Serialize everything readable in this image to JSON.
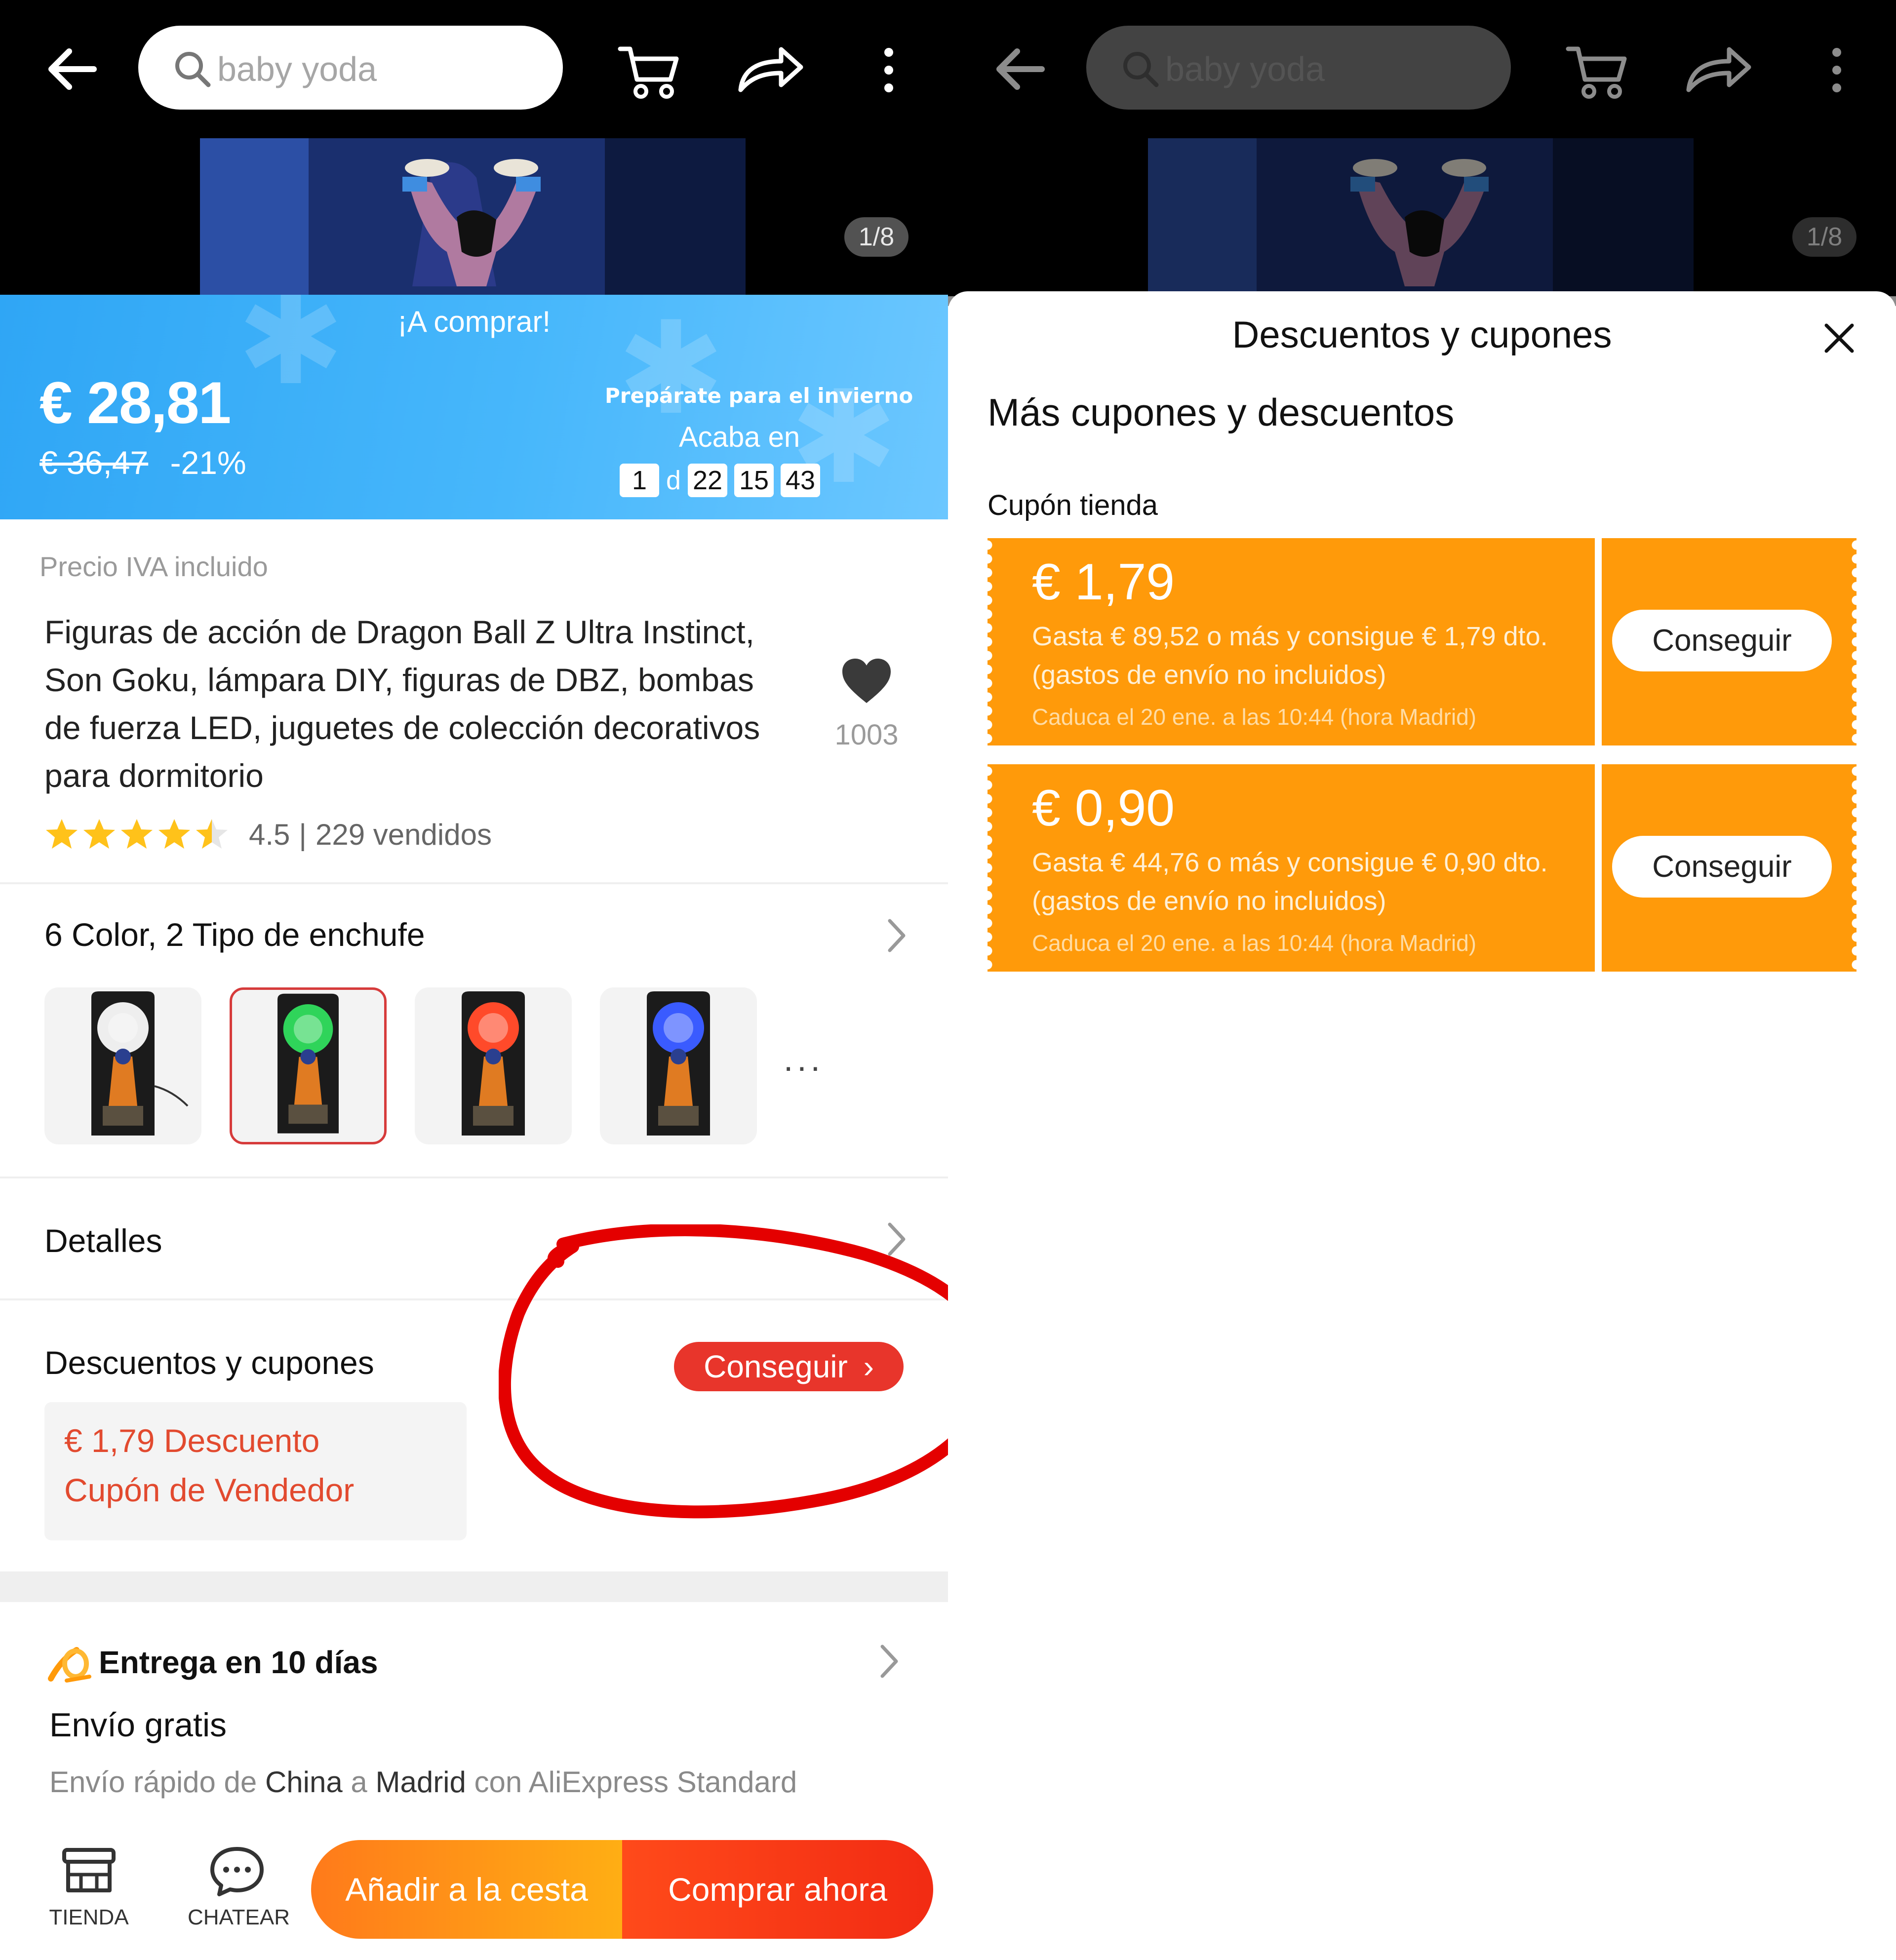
{
  "left": {
    "topbar": {
      "search_value": "baby yoda"
    },
    "media": {
      "counter": "1/8"
    },
    "promo": {
      "title": "¡A comprar!",
      "price": "€ 28,81",
      "old_price": "€ 36,47",
      "discount": "-21%",
      "tagline": "Prepárate para el invierno",
      "ends_label": "Acaba en",
      "countdown": {
        "days": "1",
        "days_unit": "d",
        "hours": "22",
        "minutes": "15",
        "seconds": "43"
      }
    },
    "product": {
      "vat_note": "Precio IVA incluido",
      "title": "Figuras de acción de Dragon Ball Z Ultra Instinct, Son Goku, lámpara DIY, figuras de DBZ, bombas de fuerza LED, juguetes de colección decorativos para dormitorio",
      "wishlist_count": "1003",
      "rating": "4.5",
      "rating_value": 4.5,
      "sold": "229 vendidos"
    },
    "variants": {
      "label": "6 Color, 2 Tipo de enchufe",
      "more": "···",
      "items": [
        {
          "name": "white",
          "glow": "#eeeeee",
          "selected": false
        },
        {
          "name": "green",
          "glow": "#2fd45a",
          "selected": true
        },
        {
          "name": "red",
          "glow": "#ff4a2a",
          "selected": false
        },
        {
          "name": "blue",
          "glow": "#3a5bff",
          "selected": false
        }
      ]
    },
    "details": {
      "label": "Detalles"
    },
    "discounts": {
      "label": "Descuentos y cupones",
      "get_label": "Conseguir",
      "coupon_line1": "€ 1,79 Descuento",
      "coupon_line2": "Cupón de Vendedor"
    },
    "delivery": {
      "title": "Entrega en 10 días",
      "shipping": "Envío gratis",
      "desc_prefix": "Envío rápido de ",
      "from": "China",
      "desc_mid": " a ",
      "to": "Madrid",
      "desc_suffix": " con AliExpress Standard"
    },
    "bottom_bar": {
      "store_label": "TIENDA",
      "chat_label": "CHATEAR",
      "add_to_cart": "Añadir a la cesta",
      "buy_now": "Comprar ahora"
    }
  },
  "right": {
    "topbar": {
      "search_value": "baby yoda"
    },
    "media": {
      "counter": "1/8"
    },
    "sheet": {
      "title": "Descuentos y cupones",
      "subtitle": "Más cupones y descuentos",
      "section": "Cupón tienda",
      "coupons": [
        {
          "amount": "€ 1,79",
          "condition": "Gasta € 89,52 o más y consigue € 1,79 dto. (gastos de envío no incluidos)",
          "expiry": "Caduca el 20 ene. a las 10:44 (hora Madrid)",
          "button": "Conseguir"
        },
        {
          "amount": "€ 0,90",
          "condition": "Gasta € 44,76 o más y consigue € 0,90 dto. (gastos de envío no incluidos)",
          "expiry": "Caduca el 20 ene. a las 10:44 (hora Madrid)",
          "button": "Conseguir"
        }
      ]
    }
  },
  "colors": {
    "promo_blue": "#2fa6f5",
    "accent_red": "#e8352b",
    "coupon_orange": "#ff9a0a",
    "add_cart_orange": "#ff7a1a",
    "buy_now_red": "#f22b13",
    "annotation_red": "#e40000"
  }
}
